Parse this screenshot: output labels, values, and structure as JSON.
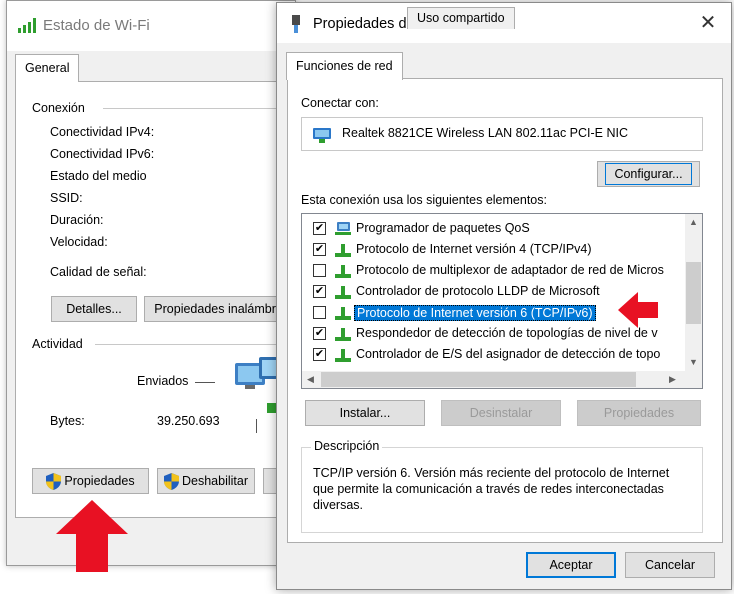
{
  "status_window": {
    "title": "Estado de Wi-Fi",
    "tab_general": "General",
    "connection_group": "Conexión",
    "rows": {
      "ipv4": "Conectividad IPv4:",
      "ipv6": "Conectividad IPv6:",
      "media": "Estado del medio",
      "ssid": "SSID:",
      "duration": "Duración:",
      "speed": "Velocidad:",
      "signal": "Calidad de señal:"
    },
    "details_button": "Detalles...",
    "wireless_props_button": "Propiedades inalámbri",
    "activity_group": "Actividad",
    "sent_label": "Enviados",
    "bytes_label": "Bytes:",
    "bytes_sent": "39.250.693",
    "properties_button": "Propiedades",
    "disable_button": "Deshabilitar"
  },
  "props_window": {
    "title": "Propiedades de Wi-Fi",
    "close_glyph": "✕",
    "tabs": [
      "Funciones de red",
      "Uso compartido"
    ],
    "connect_with_label": "Conectar con:",
    "adapter_name": "Realtek 8821CE Wireless LAN 802.11ac PCI-E NIC",
    "configure_button": "Configurar...",
    "items_label": "Esta conexión usa los siguientes elementos:",
    "items": [
      {
        "label": "Programador de paquetes QoS",
        "checked": true,
        "icon": "qos-scheduler-icon"
      },
      {
        "label": "Protocolo de Internet versión 4 (TCP/IPv4)",
        "checked": true,
        "icon": "protocol-icon"
      },
      {
        "label": "Protocolo de multiplexor de adaptador de red de Micros",
        "checked": false,
        "icon": "protocol-icon"
      },
      {
        "label": "Controlador de protocolo LLDP de Microsoft",
        "checked": true,
        "icon": "protocol-icon"
      },
      {
        "label": "Protocolo de Internet versión 6 (TCP/IPv6)",
        "checked": false,
        "icon": "protocol-icon",
        "selected": true
      },
      {
        "label": "Respondedor de detección de topologías de nivel de v",
        "checked": true,
        "icon": "protocol-icon"
      },
      {
        "label": "Controlador de E/S del asignador de detección de topo",
        "checked": true,
        "icon": "protocol-icon"
      }
    ],
    "install_button": "Instalar...",
    "uninstall_button": "Desinstalar",
    "properties_button": "Propiedades",
    "description_label": "Descripción",
    "description_text": "TCP/IP versión 6. Versión más reciente del protocolo de Internet que permite la comunicación a través de redes interconectadas diversas.",
    "accept_button": "Aceptar",
    "cancel_button": "Cancelar"
  },
  "colors": {
    "selection": "#0078d7",
    "annotation_arrow": "#e81123",
    "window_bg": "#f0f0f0"
  }
}
